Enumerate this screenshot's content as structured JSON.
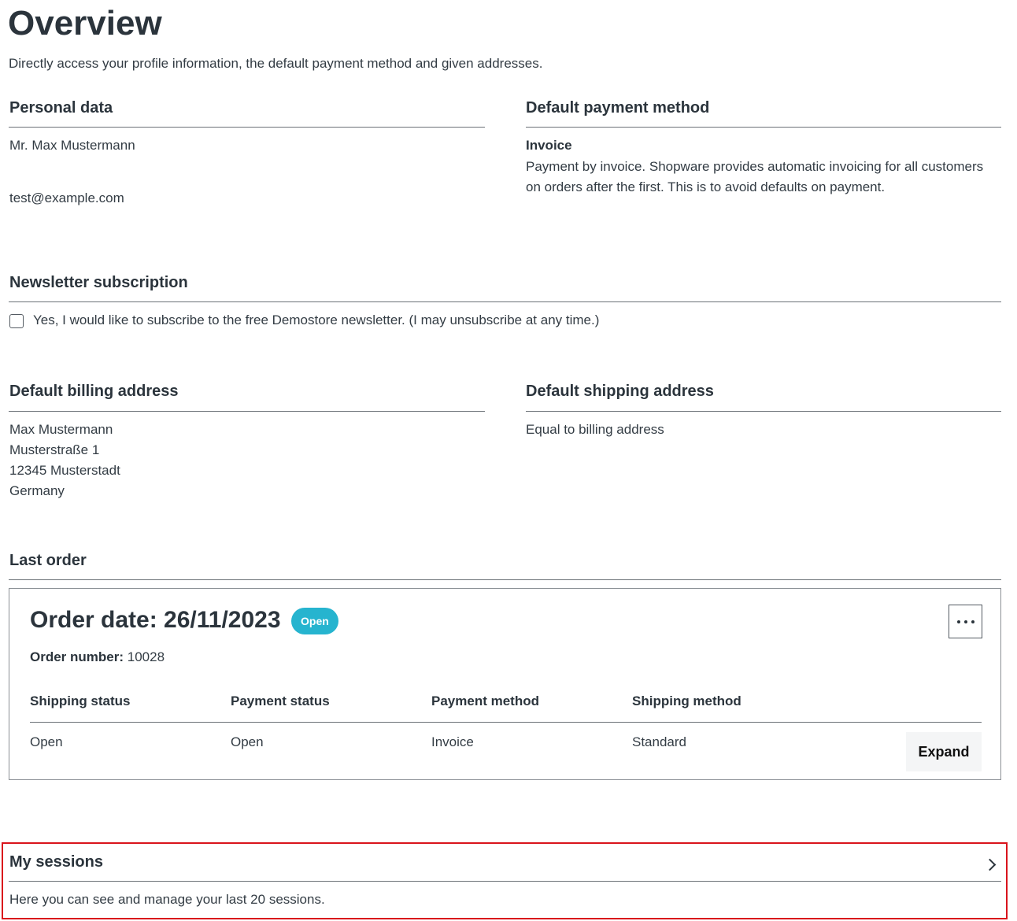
{
  "page": {
    "title": "Overview",
    "lead": "Directly access your profile information, the default payment method and given addresses."
  },
  "personal": {
    "title": "Personal data",
    "name": "Mr. Max Mustermann",
    "email": "test@example.com"
  },
  "payment": {
    "title": "Default payment method",
    "method": "Invoice",
    "description_line1": "Payment by invoice. Shopware provides automatic invoicing for all customers",
    "description_line2": "on orders after the first. This is to avoid defaults on payment."
  },
  "newsletter": {
    "title": "Newsletter subscription",
    "checkbox_label": "Yes, I would like to subscribe to the free Demostore newsletter. (I may unsubscribe at any time.)",
    "checked": false
  },
  "billing": {
    "title": "Default billing address",
    "lines": [
      "Max Mustermann",
      "Musterstraße 1",
      "12345 Musterstadt",
      "Germany"
    ]
  },
  "shipping": {
    "title": "Default shipping address",
    "text": "Equal to billing address"
  },
  "last_order": {
    "title": "Last order",
    "order_date_label": "Order date: 26/11/2023",
    "status_badge": "Open",
    "order_number_label": "Order number:",
    "order_number": "10028",
    "columns": [
      {
        "header": "Shipping status",
        "value": "Open"
      },
      {
        "header": "Payment status",
        "value": "Open"
      },
      {
        "header": "Payment method",
        "value": "Invoice"
      },
      {
        "header": "Shipping method",
        "value": "Standard"
      }
    ],
    "expand_label": "Expand",
    "menu_icon": "more-dots-icon",
    "badge_color": "#26b4cf"
  },
  "sessions": {
    "title": "My sessions",
    "description": "Here you can see and manage your last 20 sessions.",
    "icon": "chevron-right-icon",
    "highlight_color": "#d9141c"
  }
}
